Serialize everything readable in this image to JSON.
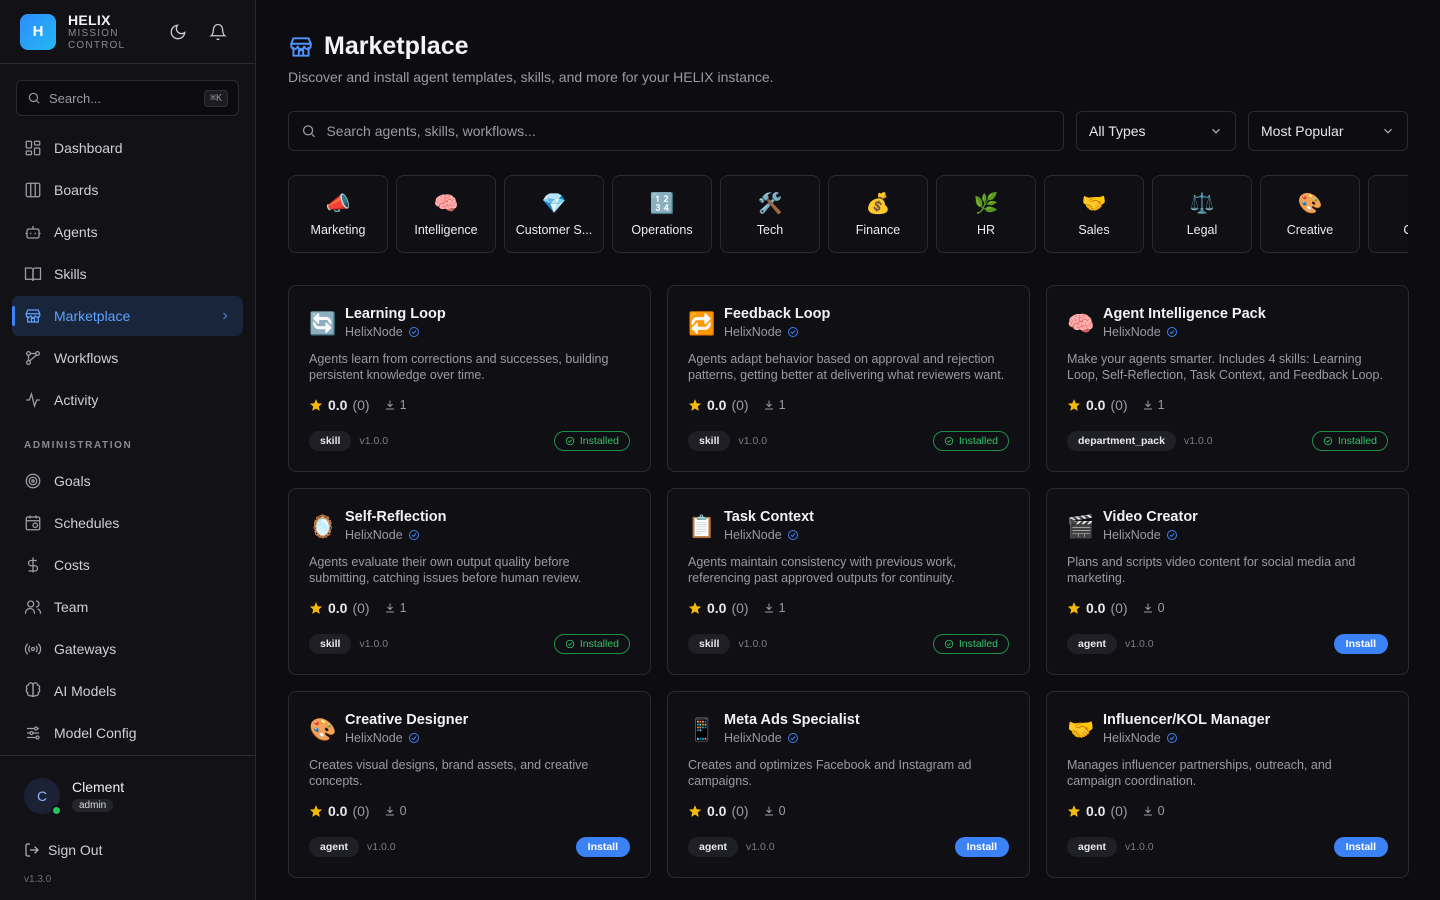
{
  "brand": {
    "logo": "H",
    "title": "HELIX",
    "subtitle": "MISSION CONTROL",
    "icons": [
      "moon-icon",
      "bell-icon"
    ]
  },
  "sidebar": {
    "search_placeholder": "Search...",
    "search_shortcut": "⌘K",
    "nav": [
      {
        "label": "Dashboard",
        "icon": "dashboard-icon",
        "active": false
      },
      {
        "label": "Boards",
        "icon": "boards-icon",
        "active": false
      },
      {
        "label": "Agents",
        "icon": "agents-icon",
        "active": false
      },
      {
        "label": "Skills",
        "icon": "book-icon",
        "active": false
      },
      {
        "label": "Marketplace",
        "icon": "store-icon",
        "active": true
      },
      {
        "label": "Workflows",
        "icon": "workflow-icon",
        "active": false
      },
      {
        "label": "Activity",
        "icon": "activity-icon",
        "active": false
      }
    ],
    "admin_label": "ADMINISTRATION",
    "admin": [
      {
        "label": "Goals",
        "icon": "target-icon"
      },
      {
        "label": "Schedules",
        "icon": "calendar-icon"
      },
      {
        "label": "Costs",
        "icon": "dollar-icon"
      },
      {
        "label": "Team",
        "icon": "users-icon"
      },
      {
        "label": "Gateways",
        "icon": "radio-icon"
      },
      {
        "label": "AI Models",
        "icon": "brain-icon"
      },
      {
        "label": "Model Config",
        "icon": "sliders-icon"
      }
    ],
    "user": {
      "initial": "C",
      "name": "Clement",
      "role": "admin"
    },
    "sign_out": "Sign Out",
    "version": "v1.3.0"
  },
  "main": {
    "title": "Marketplace",
    "description": "Discover and install agent templates, skills, and more for your HELIX instance.",
    "search_placeholder": "Search agents, skills, workflows...",
    "type_filter": "All Types",
    "sort": "Most Popular",
    "categories": [
      {
        "emoji": "📣",
        "label": "Marketing"
      },
      {
        "emoji": "🧠",
        "label": "Intelligence"
      },
      {
        "emoji": "💎",
        "label": "Customer S..."
      },
      {
        "emoji": "🔢",
        "label": "Operations"
      },
      {
        "emoji": "🛠️",
        "label": "Tech"
      },
      {
        "emoji": "💰",
        "label": "Finance"
      },
      {
        "emoji": "🌿",
        "label": "HR"
      },
      {
        "emoji": "🤝",
        "label": "Sales"
      },
      {
        "emoji": "⚖️",
        "label": "Legal"
      },
      {
        "emoji": "🎨",
        "label": "Creative"
      },
      {
        "emoji": "",
        "label": "Copy"
      }
    ],
    "cards": [
      {
        "icon": "🔄",
        "name": "Learning Loop",
        "author": "HelixNode",
        "desc": "Agents learn from corrections and successes, building persistent knowledge over time.",
        "rating": "0.0",
        "reviews": "(0)",
        "downloads": "1",
        "type": "skill",
        "version": "v1.0.0",
        "installed": true,
        "action": "Installed"
      },
      {
        "icon": "🔁",
        "name": "Feedback Loop",
        "author": "HelixNode",
        "desc": "Agents adapt behavior based on approval and rejection patterns, getting better at delivering what reviewers want.",
        "rating": "0.0",
        "reviews": "(0)",
        "downloads": "1",
        "type": "skill",
        "version": "v1.0.0",
        "installed": true,
        "action": "Installed"
      },
      {
        "icon": "🧠",
        "name": "Agent Intelligence Pack",
        "author": "HelixNode",
        "desc": "Make your agents smarter. Includes 4 skills: Learning Loop, Self-Reflection, Task Context, and Feedback Loop.",
        "rating": "0.0",
        "reviews": "(0)",
        "downloads": "1",
        "type": "department_pack",
        "version": "v1.0.0",
        "installed": true,
        "action": "Installed"
      },
      {
        "icon": "🪞",
        "name": "Self-Reflection",
        "author": "HelixNode",
        "desc": "Agents evaluate their own output quality before submitting, catching issues before human review.",
        "rating": "0.0",
        "reviews": "(0)",
        "downloads": "1",
        "type": "skill",
        "version": "v1.0.0",
        "installed": true,
        "action": "Installed"
      },
      {
        "icon": "📋",
        "name": "Task Context",
        "author": "HelixNode",
        "desc": "Agents maintain consistency with previous work, referencing past approved outputs for continuity.",
        "rating": "0.0",
        "reviews": "(0)",
        "downloads": "1",
        "type": "skill",
        "version": "v1.0.0",
        "installed": true,
        "action": "Installed"
      },
      {
        "icon": "🎬",
        "name": "Video Creator",
        "author": "HelixNode",
        "desc": "Plans and scripts video content for social media and marketing.",
        "rating": "0.0",
        "reviews": "(0)",
        "downloads": "0",
        "type": "agent",
        "version": "v1.0.0",
        "installed": false,
        "action": "Install"
      },
      {
        "icon": "🎨",
        "name": "Creative Designer",
        "author": "HelixNode",
        "desc": "Creates visual designs, brand assets, and creative concepts.",
        "rating": "0.0",
        "reviews": "(0)",
        "downloads": "0",
        "type": "agent",
        "version": "v1.0.0",
        "installed": false,
        "action": "Install"
      },
      {
        "icon": "📱",
        "name": "Meta Ads Specialist",
        "author": "HelixNode",
        "desc": "Creates and optimizes Facebook and Instagram ad campaigns.",
        "rating": "0.0",
        "reviews": "(0)",
        "downloads": "0",
        "type": "agent",
        "version": "v1.0.0",
        "installed": false,
        "action": "Install"
      },
      {
        "icon": "🤝",
        "name": "Influencer/KOL Manager",
        "author": "HelixNode",
        "desc": "Manages influencer partnerships, outreach, and campaign coordination.",
        "rating": "0.0",
        "reviews": "(0)",
        "downloads": "0",
        "type": "agent",
        "version": "v1.0.0",
        "installed": false,
        "action": "Install"
      }
    ]
  }
}
